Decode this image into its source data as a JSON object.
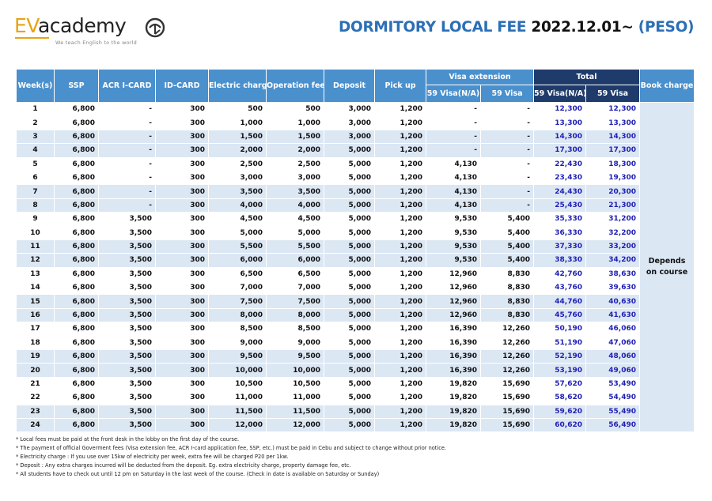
{
  "logo": {
    "ev": "EV",
    "academy": "academy",
    "tagline": "We teach English to the world"
  },
  "title": {
    "part1": "DORMITORY LOCAL FEE",
    "date": "2022.12.01~",
    "unit": "(PESO)"
  },
  "table": {
    "headers": {
      "week": "Week(s)",
      "ssp": "SSP",
      "acr": "ACR I-CARD",
      "id_card": "ID-CARD",
      "electric": "Electric charge",
      "operation": "Operation fee",
      "deposit": "Deposit",
      "pickup": "Pick up",
      "visa_extension": "Visa extension",
      "visa_na": "59 Visa(N/A)",
      "visa_59": "59 Visa",
      "total": "Total",
      "total_na": "59 Visa(N/A)",
      "total_59": "59 Visa",
      "book": "Book charge"
    },
    "book_charge": "Depends on course",
    "rows": [
      {
        "week": "1",
        "ssp": "6,800",
        "acr": "-",
        "id": "300",
        "elec": "500",
        "op": "500",
        "dep": "3,000",
        "pick": "1,200",
        "vna": "-",
        "v59": "-",
        "tna": "12,300",
        "t59": "12,300"
      },
      {
        "week": "2",
        "ssp": "6,800",
        "acr": "-",
        "id": "300",
        "elec": "1,000",
        "op": "1,000",
        "dep": "3,000",
        "pick": "1,200",
        "vna": "-",
        "v59": "-",
        "tna": "13,300",
        "t59": "13,300"
      },
      {
        "week": "3",
        "ssp": "6,800",
        "acr": "-",
        "id": "300",
        "elec": "1,500",
        "op": "1,500",
        "dep": "3,000",
        "pick": "1,200",
        "vna": "-",
        "v59": "-",
        "tna": "14,300",
        "t59": "14,300"
      },
      {
        "week": "4",
        "ssp": "6,800",
        "acr": "-",
        "id": "300",
        "elec": "2,000",
        "op": "2,000",
        "dep": "5,000",
        "pick": "1,200",
        "vna": "-",
        "v59": "-",
        "tna": "17,300",
        "t59": "17,300"
      },
      {
        "week": "5",
        "ssp": "6,800",
        "acr": "-",
        "id": "300",
        "elec": "2,500",
        "op": "2,500",
        "dep": "5,000",
        "pick": "1,200",
        "vna": "4,130",
        "v59": "-",
        "tna": "22,430",
        "t59": "18,300"
      },
      {
        "week": "6",
        "ssp": "6,800",
        "acr": "-",
        "id": "300",
        "elec": "3,000",
        "op": "3,000",
        "dep": "5,000",
        "pick": "1,200",
        "vna": "4,130",
        "v59": "-",
        "tna": "23,430",
        "t59": "19,300"
      },
      {
        "week": "7",
        "ssp": "6,800",
        "acr": "-",
        "id": "300",
        "elec": "3,500",
        "op": "3,500",
        "dep": "5,000",
        "pick": "1,200",
        "vna": "4,130",
        "v59": "-",
        "tna": "24,430",
        "t59": "20,300"
      },
      {
        "week": "8",
        "ssp": "6,800",
        "acr": "-",
        "id": "300",
        "elec": "4,000",
        "op": "4,000",
        "dep": "5,000",
        "pick": "1,200",
        "vna": "4,130",
        "v59": "-",
        "tna": "25,430",
        "t59": "21,300"
      },
      {
        "week": "9",
        "ssp": "6,800",
        "acr": "3,500",
        "id": "300",
        "elec": "4,500",
        "op": "4,500",
        "dep": "5,000",
        "pick": "1,200",
        "vna": "9,530",
        "v59": "5,400",
        "tna": "35,330",
        "t59": "31,200"
      },
      {
        "week": "10",
        "ssp": "6,800",
        "acr": "3,500",
        "id": "300",
        "elec": "5,000",
        "op": "5,000",
        "dep": "5,000",
        "pick": "1,200",
        "vna": "9,530",
        "v59": "5,400",
        "tna": "36,330",
        "t59": "32,200"
      },
      {
        "week": "11",
        "ssp": "6,800",
        "acr": "3,500",
        "id": "300",
        "elec": "5,500",
        "op": "5,500",
        "dep": "5,000",
        "pick": "1,200",
        "vna": "9,530",
        "v59": "5,400",
        "tna": "37,330",
        "t59": "33,200"
      },
      {
        "week": "12",
        "ssp": "6,800",
        "acr": "3,500",
        "id": "300",
        "elec": "6,000",
        "op": "6,000",
        "dep": "5,000",
        "pick": "1,200",
        "vna": "9,530",
        "v59": "5,400",
        "tna": "38,330",
        "t59": "34,200"
      },
      {
        "week": "13",
        "ssp": "6,800",
        "acr": "3,500",
        "id": "300",
        "elec": "6,500",
        "op": "6,500",
        "dep": "5,000",
        "pick": "1,200",
        "vna": "12,960",
        "v59": "8,830",
        "tna": "42,760",
        "t59": "38,630"
      },
      {
        "week": "14",
        "ssp": "6,800",
        "acr": "3,500",
        "id": "300",
        "elec": "7,000",
        "op": "7,000",
        "dep": "5,000",
        "pick": "1,200",
        "vna": "12,960",
        "v59": "8,830",
        "tna": "43,760",
        "t59": "39,630"
      },
      {
        "week": "15",
        "ssp": "6,800",
        "acr": "3,500",
        "id": "300",
        "elec": "7,500",
        "op": "7,500",
        "dep": "5,000",
        "pick": "1,200",
        "vna": "12,960",
        "v59": "8,830",
        "tna": "44,760",
        "t59": "40,630"
      },
      {
        "week": "16",
        "ssp": "6,800",
        "acr": "3,500",
        "id": "300",
        "elec": "8,000",
        "op": "8,000",
        "dep": "5,000",
        "pick": "1,200",
        "vna": "12,960",
        "v59": "8,830",
        "tna": "45,760",
        "t59": "41,630"
      },
      {
        "week": "17",
        "ssp": "6,800",
        "acr": "3,500",
        "id": "300",
        "elec": "8,500",
        "op": "8,500",
        "dep": "5,000",
        "pick": "1,200",
        "vna": "16,390",
        "v59": "12,260",
        "tna": "50,190",
        "t59": "46,060"
      },
      {
        "week": "18",
        "ssp": "6,800",
        "acr": "3,500",
        "id": "300",
        "elec": "9,000",
        "op": "9,000",
        "dep": "5,000",
        "pick": "1,200",
        "vna": "16,390",
        "v59": "12,260",
        "tna": "51,190",
        "t59": "47,060"
      },
      {
        "week": "19",
        "ssp": "6,800",
        "acr": "3,500",
        "id": "300",
        "elec": "9,500",
        "op": "9,500",
        "dep": "5,000",
        "pick": "1,200",
        "vna": "16,390",
        "v59": "12,260",
        "tna": "52,190",
        "t59": "48,060"
      },
      {
        "week": "20",
        "ssp": "6,800",
        "acr": "3,500",
        "id": "300",
        "elec": "10,000",
        "op": "10,000",
        "dep": "5,000",
        "pick": "1,200",
        "vna": "16,390",
        "v59": "12,260",
        "tna": "53,190",
        "t59": "49,060"
      },
      {
        "week": "21",
        "ssp": "6,800",
        "acr": "3,500",
        "id": "300",
        "elec": "10,500",
        "op": "10,500",
        "dep": "5,000",
        "pick": "1,200",
        "vna": "19,820",
        "v59": "15,690",
        "tna": "57,620",
        "t59": "53,490"
      },
      {
        "week": "22",
        "ssp": "6,800",
        "acr": "3,500",
        "id": "300",
        "elec": "11,000",
        "op": "11,000",
        "dep": "5,000",
        "pick": "1,200",
        "vna": "19,820",
        "v59": "15,690",
        "tna": "58,620",
        "t59": "54,490"
      },
      {
        "week": "23",
        "ssp": "6,800",
        "acr": "3,500",
        "id": "300",
        "elec": "11,500",
        "op": "11,500",
        "dep": "5,000",
        "pick": "1,200",
        "vna": "19,820",
        "v59": "15,690",
        "tna": "59,620",
        "t59": "55,490"
      },
      {
        "week": "24",
        "ssp": "6,800",
        "acr": "3,500",
        "id": "300",
        "elec": "12,000",
        "op": "12,000",
        "dep": "5,000",
        "pick": "1,200",
        "vna": "19,820",
        "v59": "15,690",
        "tna": "60,620",
        "t59": "56,490"
      }
    ]
  },
  "notes": [
    "* Local fees must be paid at the front desk in the lobby on the first day of the course.",
    "* The payment of official Goverment fees (Visa extension fee, ACR I-card application fee, SSP, etc.) must be paid in Cebu and subject to change without prior notice.",
    "* Electricity charge : If you use over 15kw of electricity per week, extra fee will be charged P20 per 1kw.",
    "* Deposit : Any extra charges incurred will be deducted from the deposit. Eg. extra electricity charge, property damage fee, etc.",
    "* All students have to check out until 12 pm on Saturday in the last week of the course. (Check in date is available on Saturday or Sunday)"
  ]
}
